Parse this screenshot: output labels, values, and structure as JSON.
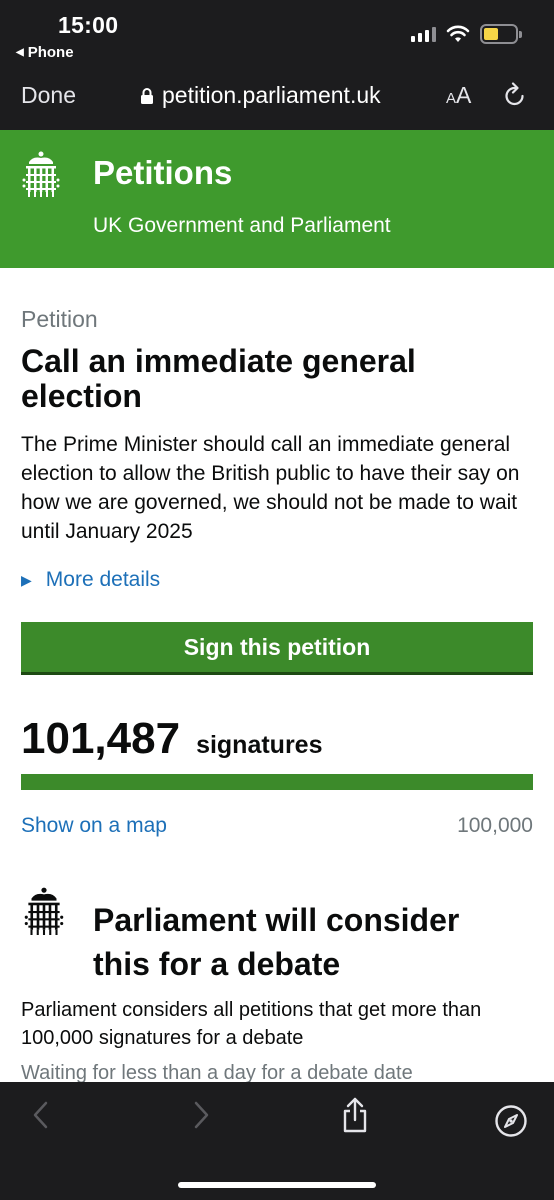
{
  "status_bar": {
    "time": "15:00",
    "back_app": "Phone"
  },
  "browser": {
    "done_label": "Done",
    "url": "petition.parliament.uk",
    "reader_small": "A",
    "reader_large": "A"
  },
  "header": {
    "title": "Petitions",
    "subtitle": "UK Government and Parliament"
  },
  "petition": {
    "kicker": "Petition",
    "title": "Call an immediate general election",
    "description": "The Prime Minister should call an immediate general election to allow the British public to have their say on how we are governed, we should not be made to wait until January 2025",
    "more_details": "More details",
    "sign_button": "Sign this petition"
  },
  "signatures": {
    "count": "101,487",
    "label": "signatures",
    "progress_fraction": 1.0,
    "map_link": "Show on a map",
    "threshold": "100,000"
  },
  "debate": {
    "title": "Parliament will consider this for a debate",
    "description": "Parliament considers all petitions that get more than 100,000 signatures for a debate",
    "waiting": "Waiting for less than a day for a debate date"
  },
  "colors": {
    "brand_green": "#3f9a2d",
    "button_green": "#3c8a2a",
    "link_blue": "#1d70b8"
  }
}
